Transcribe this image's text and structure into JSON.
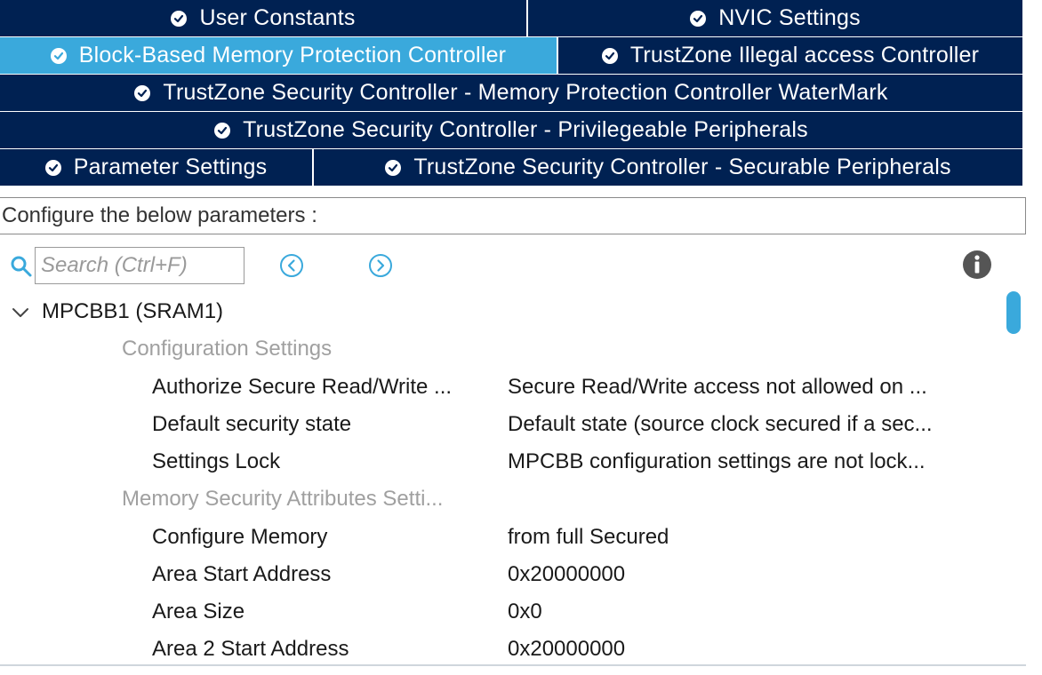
{
  "tabs": {
    "rows": [
      [
        {
          "label": "User Constants",
          "active": false
        },
        {
          "label": "NVIC Settings",
          "active": false
        }
      ],
      [
        {
          "label": "Block-Based Memory Protection Controller",
          "active": true
        },
        {
          "label": "TrustZone Illegal access Controller",
          "active": false
        }
      ],
      [
        {
          "label": "TrustZone Security Controller - Memory Protection Controller WaterMark",
          "active": false
        }
      ],
      [
        {
          "label": "TrustZone Security Controller - Privilegeable Peripherals",
          "active": false
        }
      ],
      [
        {
          "label": "Parameter Settings",
          "active": false
        },
        {
          "label": "TrustZone Security Controller - Securable Peripherals",
          "active": false
        }
      ]
    ]
  },
  "config": {
    "label": "Configure the below parameters :",
    "search_placeholder": "Search (Ctrl+F)"
  },
  "tree": {
    "root": "MPCBB1 (SRAM1)",
    "group1": "Configuration Settings",
    "group2": "Memory Security Attributes Setti...",
    "params": [
      {
        "name": "Authorize Secure Read/Write ...",
        "value": "Secure Read/Write access not allowed on ..."
      },
      {
        "name": "Default security state",
        "value": "Default state (source clock secured if a sec..."
      },
      {
        "name": "Settings Lock",
        "value": "MPCBB configuration settings are not lock..."
      },
      {
        "name": "Configure Memory",
        "value": "from full Secured"
      },
      {
        "name": "Area Start Address",
        "value": "0x20000000"
      },
      {
        "name": "Area Size",
        "value": "0x0"
      },
      {
        "name": "Area 2 Start Address",
        "value": "0x20000000"
      }
    ]
  },
  "colors": {
    "tab_bg": "#002152",
    "tab_active_bg": "#3aa9dc",
    "accent": "#3aa9dc",
    "group_text": "#a0a0a0"
  },
  "icons": {
    "tab_status": "check-circle-icon",
    "search": "search-icon",
    "prev": "chevron-left-circle-icon",
    "next": "chevron-right-circle-icon",
    "info": "info-icon",
    "tree_toggle": "chevron-down-icon"
  }
}
